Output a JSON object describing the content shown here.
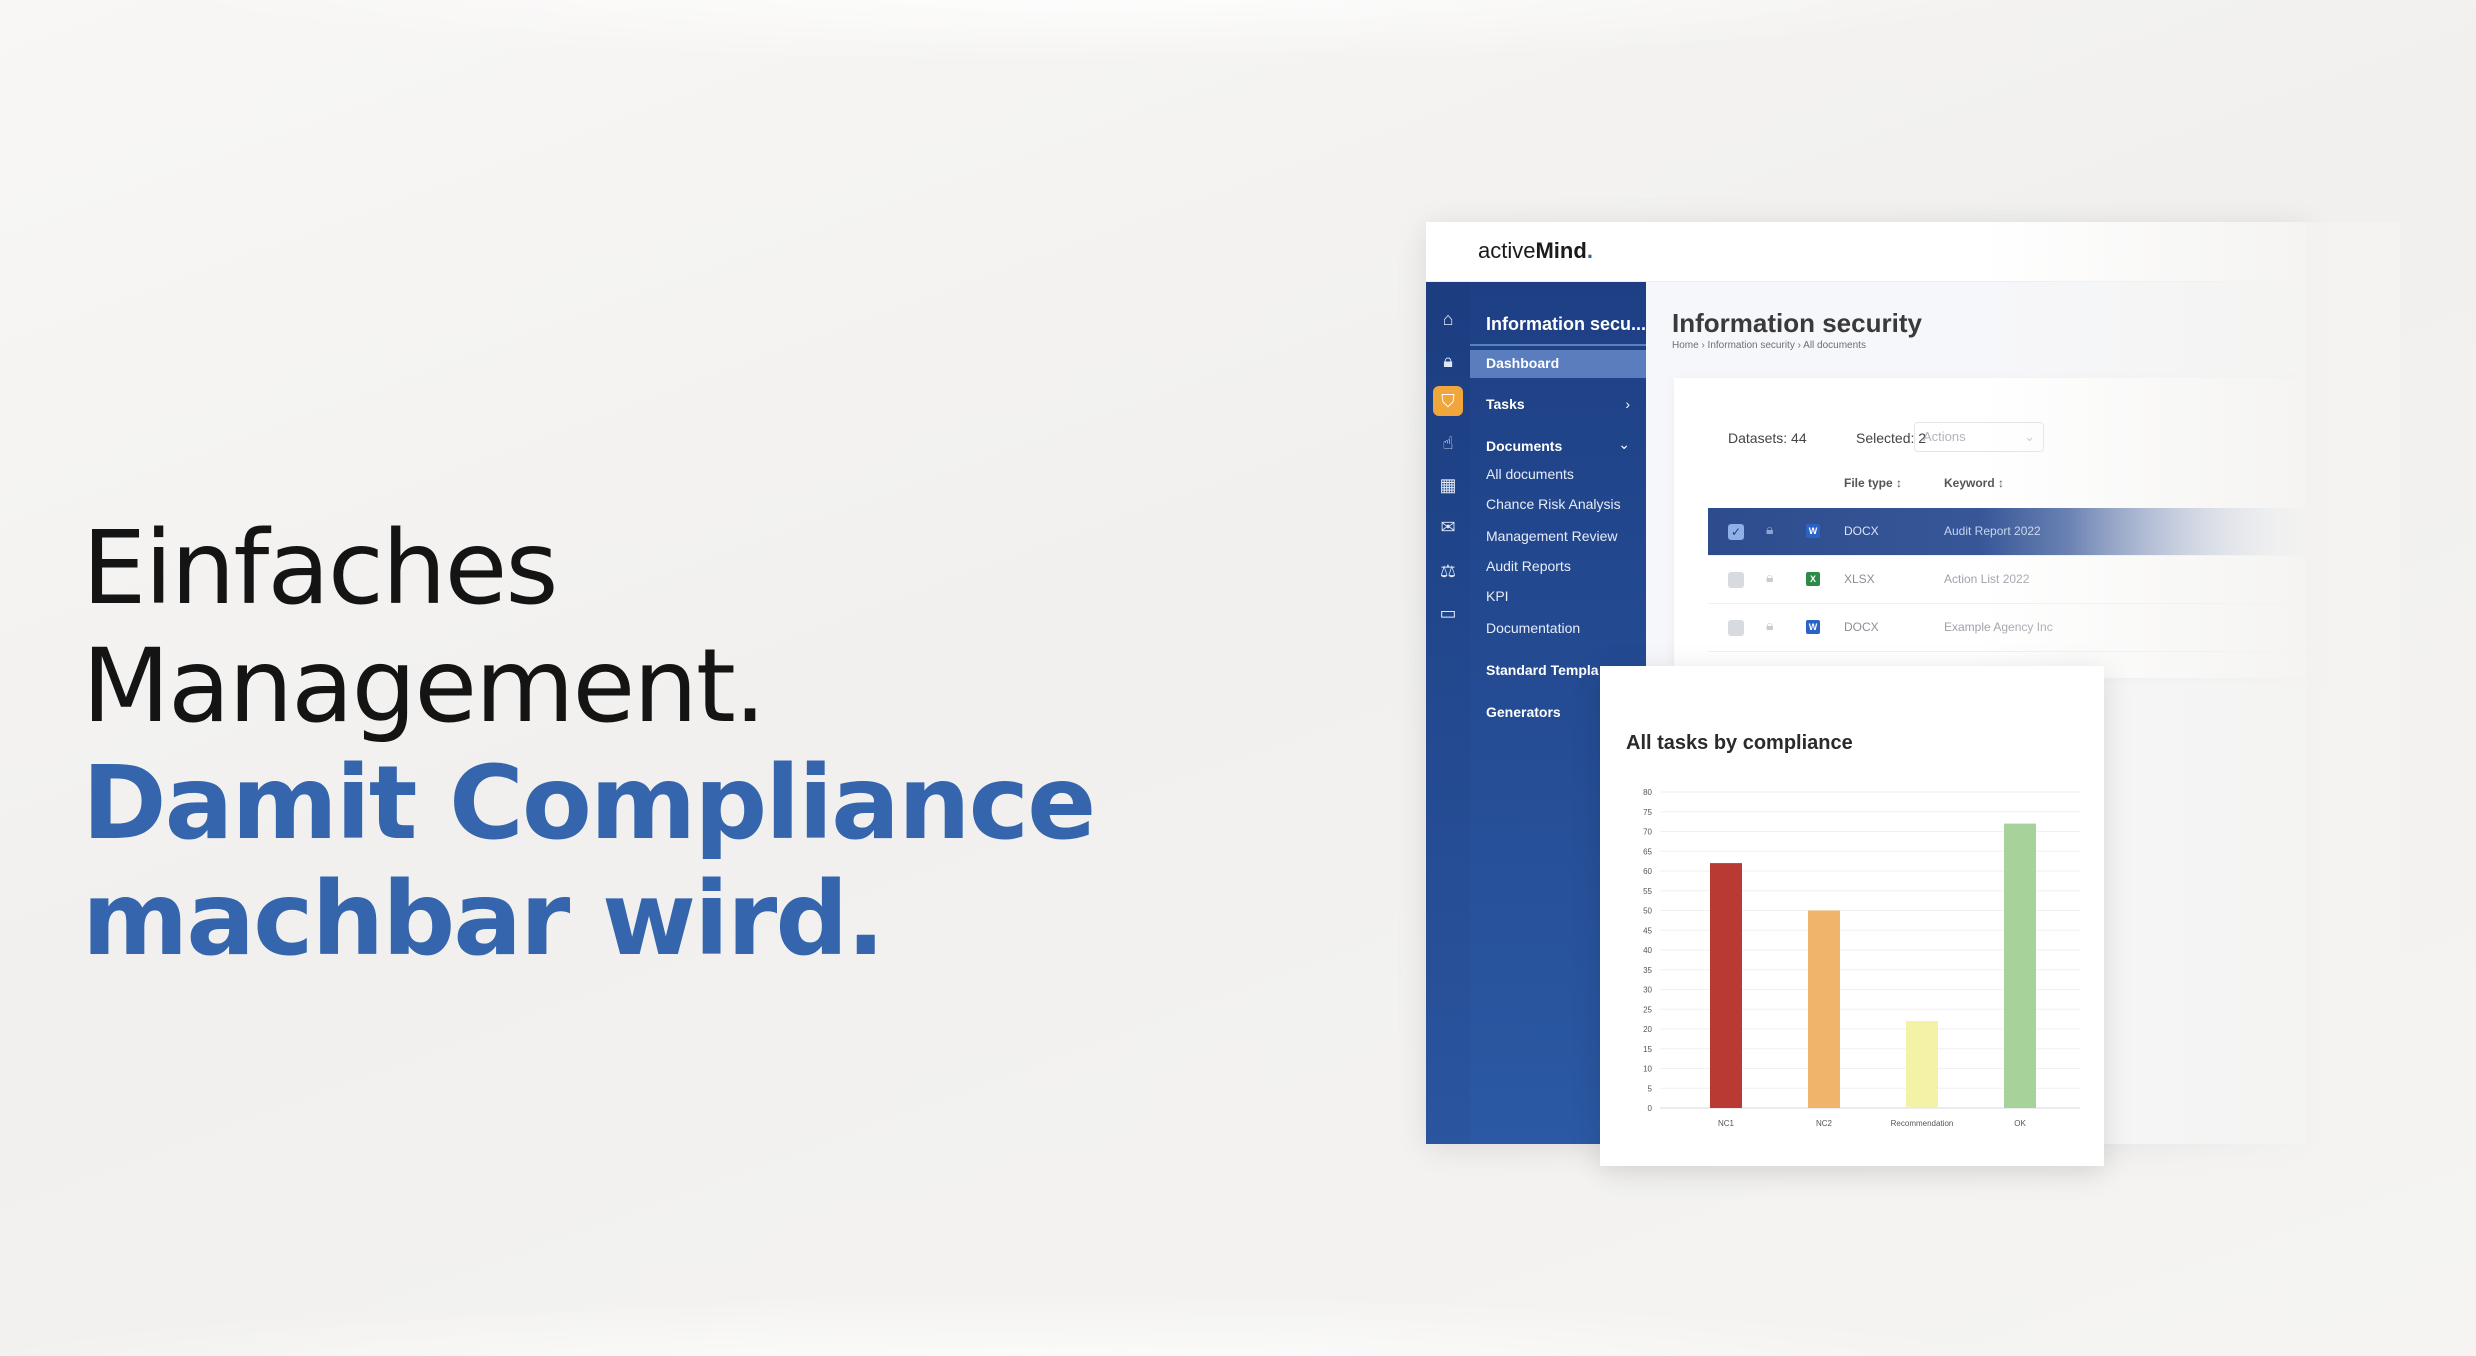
{
  "headline": {
    "line1": "Einfaches Management.",
    "line2": "Damit Compliance",
    "line3": "machbar wird."
  },
  "app": {
    "logo_prefix": "active",
    "logo_bold": "Mind",
    "logo_dot": ".",
    "rail_icons": [
      "home-icon",
      "lock-icon",
      "shield-icon",
      "hand-icon",
      "calendar-icon",
      "chat-icon",
      "scales-icon",
      "briefcase-icon"
    ],
    "sidebar": {
      "title": "Information secu...",
      "dashboard": "Dashboard",
      "tasks": "Tasks",
      "documents": "Documents",
      "documents_items": [
        "All documents",
        "Chance Risk Analysis",
        "Management Review",
        "Audit Reports",
        "KPI",
        "Documentation"
      ],
      "standard_templates": "Standard Templa",
      "generators": "Generators"
    },
    "main": {
      "title": "Information security",
      "breadcrumb": "Home  ›  Information security  ›  All documents",
      "datasets": "Datasets: 44",
      "selected": "Selected: 2",
      "actions_placeholder": "Actions",
      "col_filetype": "File type  ↕",
      "col_keyword": "Keyword  ↕",
      "rows": [
        {
          "type": "DOCX",
          "keyword": "Audit Report 2022",
          "checked": true
        },
        {
          "type": "XLSX",
          "keyword": "Action List 2022",
          "checked": false
        },
        {
          "type": "DOCX",
          "keyword": "Example Agency Inc",
          "checked": false
        }
      ]
    }
  },
  "chart_data": {
    "type": "bar",
    "title": "All tasks by compliance",
    "categories": [
      "NC1",
      "NC2",
      "Recommendation",
      "OK"
    ],
    "values": [
      62,
      50,
      22,
      72
    ],
    "colors": [
      "#b93a32",
      "#f0b56a",
      "#f3f2a6",
      "#a7d39b"
    ],
    "ylim": [
      0,
      80
    ],
    "yticks": [
      0,
      5,
      10,
      15,
      20,
      25,
      30,
      35,
      40,
      45,
      50,
      55,
      60,
      65,
      70,
      75,
      80
    ],
    "grid": true
  }
}
